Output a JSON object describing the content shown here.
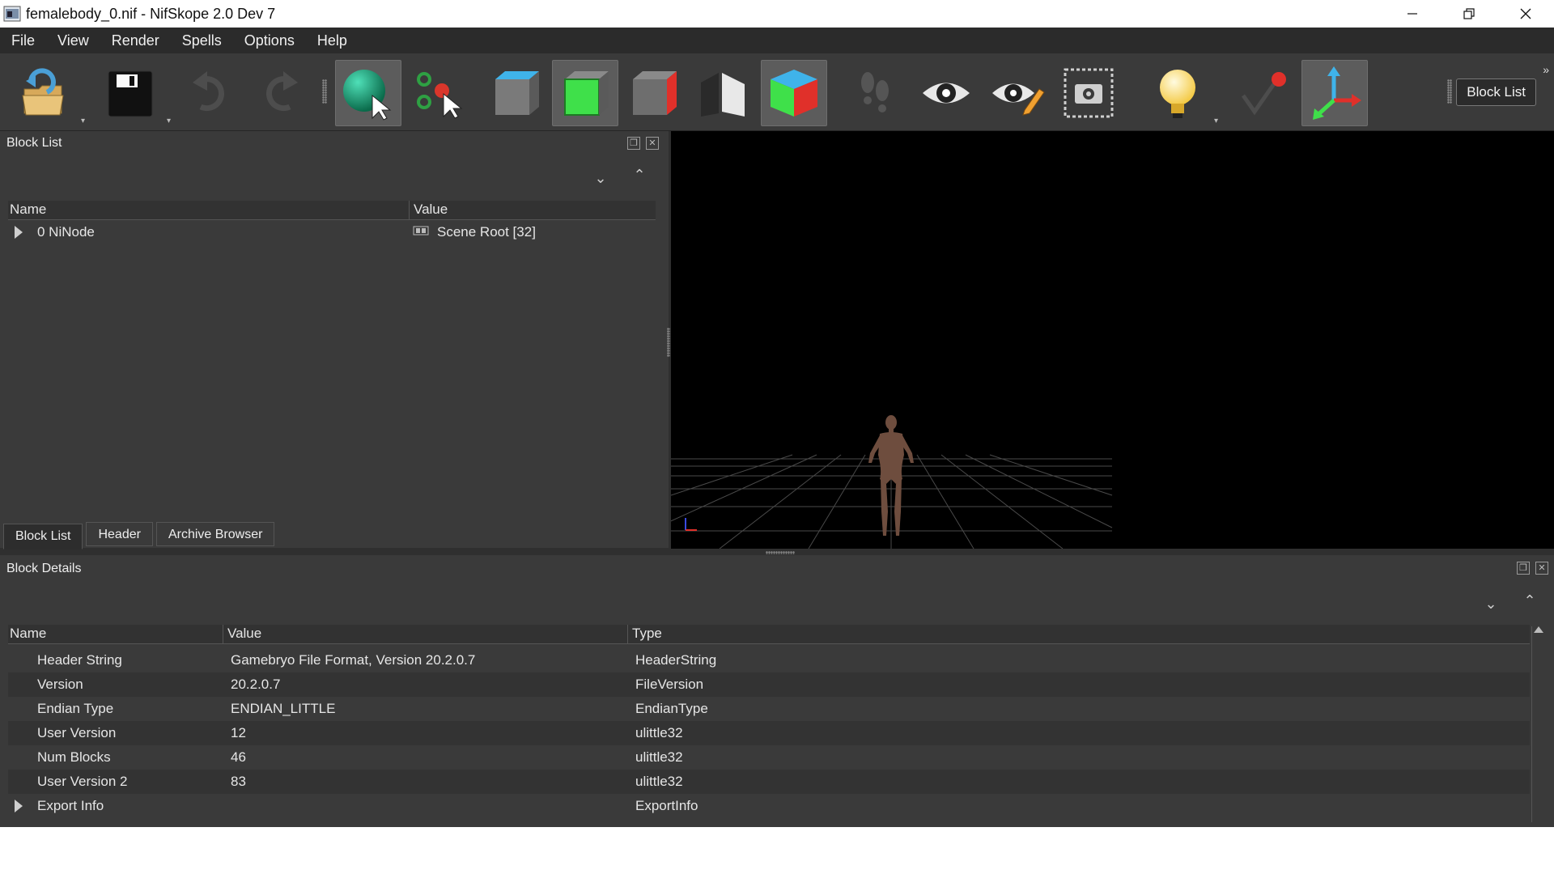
{
  "window": {
    "title": "femalebody_0.nif - NifSkope 2.0 Dev 7",
    "controls": [
      "minimize",
      "restore",
      "close"
    ]
  },
  "menu": [
    {
      "label": "File"
    },
    {
      "label": "View"
    },
    {
      "label": "Render"
    },
    {
      "label": "Spells"
    },
    {
      "label": "Options"
    },
    {
      "label": "Help"
    }
  ],
  "toolbar": {
    "buttons": [
      {
        "icon": "load-icon"
      },
      {
        "icon": "save-icon"
      },
      {
        "icon": "undo-icon"
      },
      {
        "icon": "redo-icon"
      },
      {
        "icon": "select-object-icon",
        "active": true
      },
      {
        "icon": "select-vertex-icon"
      },
      {
        "icon": "view-top-icon"
      },
      {
        "icon": "view-front-icon",
        "active": true
      },
      {
        "icon": "view-side-icon"
      },
      {
        "icon": "view-user-icon"
      },
      {
        "icon": "view-perspective-icon",
        "active": true
      },
      {
        "icon": "walk-mode-icon"
      },
      {
        "icon": "visibility-icon"
      },
      {
        "icon": "show-hidden-icon"
      },
      {
        "icon": "screenshot-icon"
      },
      {
        "icon": "lighting-icon"
      },
      {
        "icon": "vertex-colors-icon"
      },
      {
        "icon": "axes-icon",
        "active": true
      }
    ],
    "block_list_label": "Block List"
  },
  "block_list": {
    "title": "Block List",
    "columns": [
      "Name",
      "Value"
    ],
    "rows": [
      {
        "name": "0 NiNode",
        "value": "Scene Root [32]"
      }
    ],
    "tabs": [
      "Block List",
      "Header",
      "Archive Browser"
    ]
  },
  "block_details": {
    "title": "Block Details",
    "columns": [
      "Name",
      "Value",
      "Type"
    ],
    "rows": [
      {
        "name": "Header String",
        "value": "Gamebryo File Format, Version 20.2.0.7",
        "type": "HeaderString"
      },
      {
        "name": "Version",
        "value": "20.2.0.7",
        "type": "FileVersion"
      },
      {
        "name": "Endian Type",
        "value": "ENDIAN_LITTLE",
        "type": "EndianType"
      },
      {
        "name": "User Version",
        "value": "12",
        "type": "ulittle32"
      },
      {
        "name": "Num Blocks",
        "value": "46",
        "type": "ulittle32"
      },
      {
        "name": "User Version 2",
        "value": "83",
        "type": "ulittle32"
      },
      {
        "name": "Export Info",
        "value": "",
        "type": "ExportInfo"
      }
    ]
  },
  "colors": {
    "panel": "#3a3a3a",
    "viewport_bg": "#000000",
    "grid": "#5a5a5a",
    "model_skin": "#6e4d3e"
  }
}
